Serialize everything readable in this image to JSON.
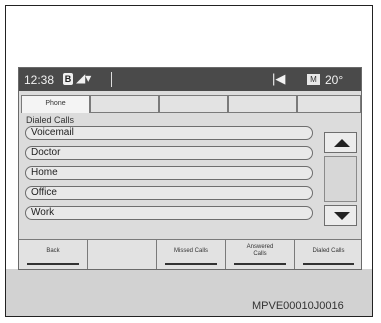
{
  "statusbar": {
    "time": "12:38",
    "bt_icon": "bluetooth-icon",
    "signal_glyph": "◢▾",
    "track_glyph": "|◀",
    "temp_box_label": "M",
    "temperature": "20°"
  },
  "tabs": [
    {
      "label": "Phone",
      "active": true
    },
    {
      "label": "",
      "active": false
    },
    {
      "label": "",
      "active": false
    },
    {
      "label": "",
      "active": false
    },
    {
      "label": "",
      "active": false
    }
  ],
  "section_title": "Dialed Calls",
  "list_items": [
    "Voicemail",
    "Doctor",
    "Home",
    "Office",
    "Work"
  ],
  "bottom_buttons": [
    {
      "label": "Back"
    },
    {
      "label": ""
    },
    {
      "label": "Missed Calls"
    },
    {
      "label": "Answered Calls"
    },
    {
      "label": "Dialed Calls"
    }
  ],
  "reference_code": "MPVE00010J0016"
}
